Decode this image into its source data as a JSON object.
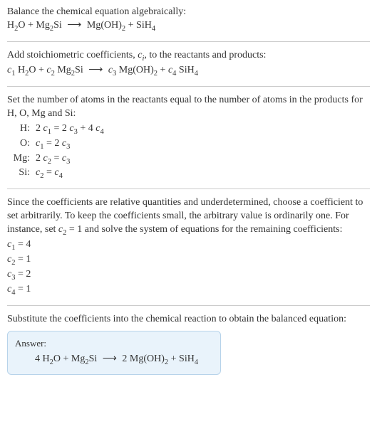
{
  "s1": {
    "line1": "Balance the chemical equation algebraically:",
    "eq": {
      "r1": "H",
      "r1s": "2",
      "r1b": "O",
      "plus1": " + ",
      "r2a": "Mg",
      "r2s": "2",
      "r2b": "Si",
      "arrow": "⟶",
      "p1a": "Mg(OH)",
      "p1s": "2",
      "plus2": " + ",
      "p2a": "SiH",
      "p2s": "4"
    }
  },
  "s2": {
    "line1a": "Add stoichiometric coefficients, ",
    "line1c": "c",
    "line1ci": "i",
    "line1b": ", to the reactants and products:",
    "eq": {
      "c1": "c",
      "c1i": "1",
      "r1": " H",
      "r1s": "2",
      "r1b": "O",
      "plus1": " + ",
      "c2": "c",
      "c2i": "2",
      "r2a": " Mg",
      "r2s": "2",
      "r2b": "Si",
      "arrow": "⟶",
      "c3": "c",
      "c3i": "3",
      "p1a": " Mg(OH)",
      "p1s": "2",
      "plus2": " + ",
      "c4": "c",
      "c4i": "4",
      "p2a": " SiH",
      "p2s": "4"
    }
  },
  "s3": {
    "intro": "Set the number of atoms in the reactants equal to the number of atoms in the products for H, O, Mg and Si:",
    "rows": {
      "H": {
        "lab": "H:",
        "lhs_a": "2 ",
        "lhs_c": "c",
        "lhs_i": "1",
        "eq": " = ",
        "rhs_a": "2 ",
        "rhs_c": "c",
        "rhs_i": "3",
        "rhs_b": " + 4 ",
        "rhs_c2": "c",
        "rhs_i2": "4"
      },
      "O": {
        "lab": "O:",
        "lhs_a": "",
        "lhs_c": "c",
        "lhs_i": "1",
        "eq": " = ",
        "rhs_a": "2 ",
        "rhs_c": "c",
        "rhs_i": "3",
        "rhs_b": "",
        "rhs_c2": "",
        "rhs_i2": ""
      },
      "Mg": {
        "lab": "Mg:",
        "lhs_a": "2 ",
        "lhs_c": "c",
        "lhs_i": "2",
        "eq": " = ",
        "rhs_a": "",
        "rhs_c": "c",
        "rhs_i": "3",
        "rhs_b": "",
        "rhs_c2": "",
        "rhs_i2": ""
      },
      "Si": {
        "lab": "Si:",
        "lhs_a": "",
        "lhs_c": "c",
        "lhs_i": "2",
        "eq": " = ",
        "rhs_a": "",
        "rhs_c": "c",
        "rhs_i": "4",
        "rhs_b": "",
        "rhs_c2": "",
        "rhs_i2": ""
      }
    }
  },
  "s4": {
    "para_a": "Since the coefficients are relative quantities and underdetermined, choose a coefficient to set arbitrarily. To keep the coefficients small, the arbitrary value is ordinarily one. For instance, set ",
    "para_c": "c",
    "para_ci": "2",
    "para_b": " = 1 and solve the system of equations for the remaining coefficients:",
    "coefs": {
      "l1": {
        "c": "c",
        "i": "1",
        "v": " = 4"
      },
      "l2": {
        "c": "c",
        "i": "2",
        "v": " = 1"
      },
      "l3": {
        "c": "c",
        "i": "3",
        "v": " = 2"
      },
      "l4": {
        "c": "c",
        "i": "4",
        "v": " = 1"
      }
    }
  },
  "s5": {
    "intro": "Substitute the coefficients into the chemical reaction to obtain the balanced equation:",
    "answer_label": "Answer:",
    "eq": {
      "a1": "4 H",
      "a1s": "2",
      "a1b": "O",
      "plus1": " + ",
      "a2a": "Mg",
      "a2s": "2",
      "a2b": "Si",
      "arrow": "⟶",
      "b1n": "2 ",
      "b1a": "Mg(OH)",
      "b1s": "2",
      "plus2": " + ",
      "b2a": "SiH",
      "b2s": "4"
    }
  }
}
